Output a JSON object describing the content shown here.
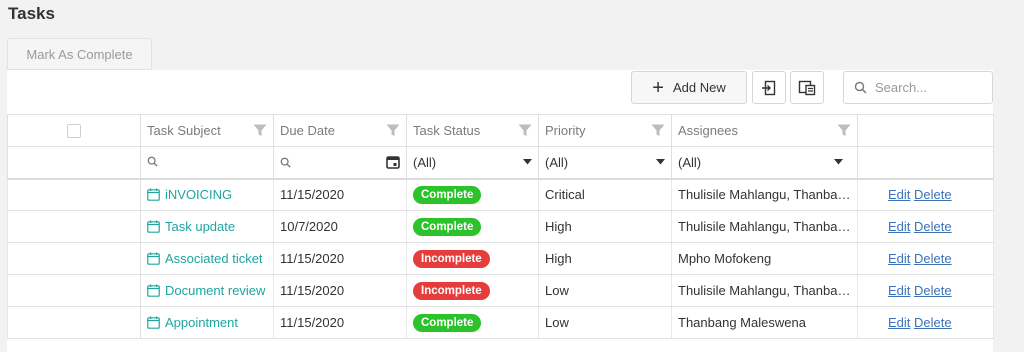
{
  "page": {
    "title": "Tasks"
  },
  "toolbar": {
    "mark_complete_label": "Mark As Complete",
    "add_new_label": "Add New",
    "search_placeholder": "Search..."
  },
  "columns": {
    "subject": "Task Subject",
    "due_date": "Due Date",
    "status": "Task Status",
    "priority": "Priority",
    "assignees": "Assignees"
  },
  "filters": {
    "status": "(All)",
    "priority": "(All)",
    "assignees": "(All)"
  },
  "actions": {
    "edit": "Edit",
    "delete": "Delete"
  },
  "rows": [
    {
      "subject": "iNVOICING",
      "due_date": "11/15/2020",
      "status": "Complete",
      "priority": "Critical",
      "assignees": "Thulisile Mahlangu, Thanbang Maleswena"
    },
    {
      "subject": "Task update",
      "due_date": "10/7/2020",
      "status": "Complete",
      "priority": "High",
      "assignees": "Thulisile Mahlangu, Thanbang Maleswena"
    },
    {
      "subject": "Associated ticket",
      "due_date": "11/15/2020",
      "status": "Incomplete",
      "priority": "High",
      "assignees": "Mpho Mofokeng"
    },
    {
      "subject": "Document review",
      "due_date": "11/15/2020",
      "status": "Incomplete",
      "priority": "Low",
      "assignees": "Thulisile Mahlangu, Thanbang Maleswena"
    },
    {
      "subject": "Appointment",
      "due_date": "11/15/2020",
      "status": "Complete",
      "priority": "Low",
      "assignees": "Thanbang Maleswena"
    }
  ],
  "colors": {
    "complete": "#2bc22b",
    "incomplete": "#e73c3c",
    "link": "#3a73b8",
    "subject": "#1ea5a0"
  },
  "icons": {
    "filter": "funnel-icon",
    "search": "magnifier-icon",
    "calendar": "calendar-icon",
    "dropdown": "caret-down-icon",
    "add": "plus-icon",
    "export": "export-icon",
    "column_chooser": "column-chooser-icon"
  }
}
